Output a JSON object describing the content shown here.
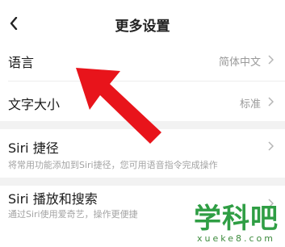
{
  "header": {
    "title": "更多设置"
  },
  "settings": {
    "language": {
      "label": "语言",
      "value": "简体中文"
    },
    "font_size": {
      "label": "文字大小",
      "value": "标准"
    },
    "siri_shortcut": {
      "label": "Siri 捷径",
      "subtitle": "将常用功能添加到Siri捷径，您可用语音指令完成操作"
    },
    "siri_play_search": {
      "label": "Siri 播放和搜索",
      "subtitle": "通过Siri使用爱奇艺，操作更便捷"
    }
  },
  "annotation": {
    "arrow_color": "#e8141b"
  },
  "watermark": {
    "title": "学科吧",
    "url": "xueke8.com"
  },
  "colors": {
    "text": "#1a1a1a",
    "secondary": "#9a9a9a",
    "section_gap": "#f2f2f2"
  }
}
